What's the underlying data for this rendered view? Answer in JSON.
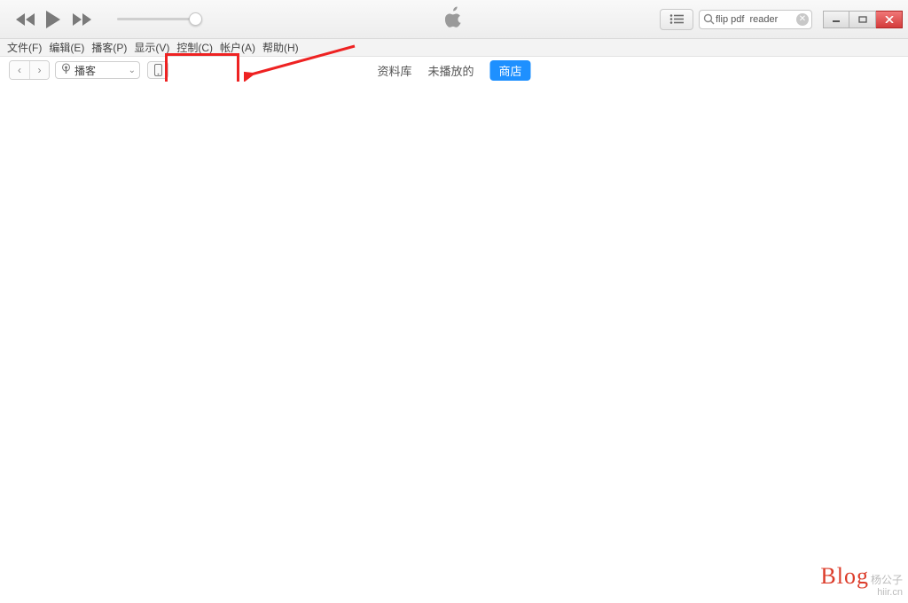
{
  "search": {
    "value": "flip pdf  reader"
  },
  "menu": {
    "file": "文件(F)",
    "edit": "编辑(E)",
    "podcast": "播客(P)",
    "view": "显示(V)",
    "control": "控制(C)",
    "account": "帐户(A)",
    "help": "帮助(H)"
  },
  "source_label": "播客",
  "tabs": {
    "library": "资料库",
    "unplayed": "未播放的",
    "store": "商店"
  },
  "watermark": {
    "brand": "Blog",
    "sub": "杨公子",
    "url": "hiir.cn"
  }
}
